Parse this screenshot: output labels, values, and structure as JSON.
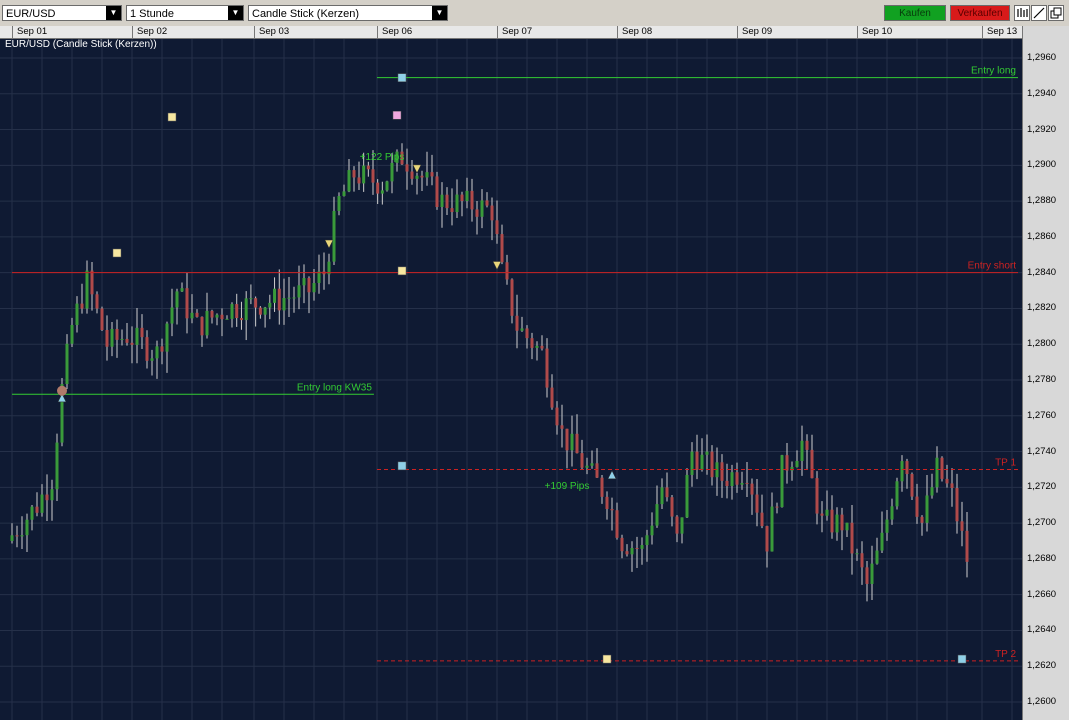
{
  "toolbar": {
    "instrument": "EUR/USD",
    "timeframe": "1 Stunde",
    "chart_type": "Candle Stick (Kerzen)",
    "buy_label": "Kaufen",
    "sell_label": "Verkaufen",
    "buy_color": "#11a121",
    "sell_color": "#d81a1a",
    "icons": [
      "chart-bars-icon",
      "draw-line-icon",
      "detach-window-icon"
    ]
  },
  "chart_title": "EUR/USD (Candle Stick (Kerzen))",
  "x_dates": [
    "Sep 01",
    "Sep 02",
    "Sep 03",
    "Sep 06",
    "Sep 07",
    "Sep 08",
    "Sep 09",
    "Sep 10",
    "Sep 13"
  ],
  "colors": {
    "background": "#0f1a33",
    "grid": "#253049",
    "bull_candle": "#3a9a3a",
    "bear_candle": "#b04a4a",
    "wick": "#cfcfcf",
    "entry_long_line": "#33cc33",
    "entry_short_line": "#cc2222",
    "tp_line": "#cc2222"
  },
  "chart_data": {
    "type": "candlestick",
    "title": "EUR/USD (Candle Stick (Kerzen))",
    "x_tick_labels": [
      "Sep 01",
      "Sep 02",
      "Sep 03",
      "Sep 06",
      "Sep 07",
      "Sep 08",
      "Sep 09",
      "Sep 10",
      "Sep 13"
    ],
    "y_tick_labels": [
      "1,2960",
      "1,2940",
      "1,2920",
      "1,2900",
      "1,2880",
      "1,2860",
      "1,2840",
      "1,2820",
      "1,2800",
      "1,2780",
      "1,2760",
      "1,2740",
      "1,2720",
      "1,2700",
      "1,2680",
      "1,2660",
      "1,2640",
      "1,2620",
      "1,2600"
    ],
    "ylim": [
      1.26,
      1.296
    ],
    "y_decimal_separator": ",",
    "grid": true,
    "path_points": [
      {
        "x": "Sep 01 00:00",
        "y": 1.269
      },
      {
        "x": "Sep 01 06:00",
        "y": 1.271
      },
      {
        "x": "Sep 01 09:00",
        "y": 1.2725
      },
      {
        "x": "Sep 01 11:00",
        "y": 1.2775
      },
      {
        "x": "Sep 01 13:00",
        "y": 1.281
      },
      {
        "x": "Sep 01 16:00",
        "y": 1.2835
      },
      {
        "x": "Sep 01 20:00",
        "y": 1.28
      },
      {
        "x": "Sep 02 00:00",
        "y": 1.2805
      },
      {
        "x": "Sep 02 06:00",
        "y": 1.2795
      },
      {
        "x": "Sep 02 10:00",
        "y": 1.283
      },
      {
        "x": "Sep 02 14:00",
        "y": 1.281
      },
      {
        "x": "Sep 02 20:00",
        "y": 1.282
      },
      {
        "x": "Sep 03 06:00",
        "y": 1.2825
      },
      {
        "x": "Sep 03 12:00",
        "y": 1.283
      },
      {
        "x": "Sep 03 15:00",
        "y": 1.284
      },
      {
        "x": "Sep 03 18:00",
        "y": 1.288
      },
      {
        "x": "Sep 03 21:00",
        "y": 1.2895
      },
      {
        "x": "Sep 06 02:00",
        "y": 1.289
      },
      {
        "x": "Sep 06 06:00",
        "y": 1.2905
      },
      {
        "x": "Sep 06 08:00",
        "y": 1.29
      },
      {
        "x": "Sep 06 14:00",
        "y": 1.288
      },
      {
        "x": "Sep 06 20:00",
        "y": 1.2878
      },
      {
        "x": "Sep 07 00:00",
        "y": 1.2875
      },
      {
        "x": "Sep 07 02:00",
        "y": 1.284
      },
      {
        "x": "Sep 07 05:00",
        "y": 1.281
      },
      {
        "x": "Sep 07 10:00",
        "y": 1.2795
      },
      {
        "x": "Sep 07 14:00",
        "y": 1.275
      },
      {
        "x": "Sep 07 19:00",
        "y": 1.273
      },
      {
        "x": "Sep 07 23:00",
        "y": 1.2715
      },
      {
        "x": "Sep 08 02:00",
        "y": 1.269
      },
      {
        "x": "Sep 08 06:00",
        "y": 1.2685
      },
      {
        "x": "Sep 08 10:00",
        "y": 1.272
      },
      {
        "x": "Sep 08 13:00",
        "y": 1.269
      },
      {
        "x": "Sep 08 16:00",
        "y": 1.274
      },
      {
        "x": "Sep 08 22:00",
        "y": 1.2725
      },
      {
        "x": "Sep 09 03:00",
        "y": 1.273
      },
      {
        "x": "Sep 09 07:00",
        "y": 1.269
      },
      {
        "x": "Sep 09 10:00",
        "y": 1.273
      },
      {
        "x": "Sep 09 14:00",
        "y": 1.2745
      },
      {
        "x": "Sep 09 18:00",
        "y": 1.27
      },
      {
        "x": "Sep 09 22:00",
        "y": 1.27
      },
      {
        "x": "Sep 10 03:00",
        "y": 1.2665
      },
      {
        "x": "Sep 10 06:00",
        "y": 1.269
      },
      {
        "x": "Sep 10 10:00",
        "y": 1.274
      },
      {
        "x": "Sep 10 14:00",
        "y": 1.27
      },
      {
        "x": "Sep 10 17:00",
        "y": 1.273
      },
      {
        "x": "Sep 10 20:00",
        "y": 1.2715
      },
      {
        "x": "Sep 10 23:00",
        "y": 1.268
      }
    ],
    "h_lines": [
      {
        "label": "Entry long",
        "price": 1.2949,
        "from": "Sep 06 00:00",
        "color": "#33cc33",
        "style": "solid"
      },
      {
        "label": "Entry short",
        "price": 1.284,
        "from": "Sep 01 00:00",
        "color": "#cc2222",
        "style": "solid"
      },
      {
        "label": "Entry long KW35",
        "price": 1.2772,
        "from": "Sep 01 00:00",
        "to": "Sep 03 23:59",
        "color": "#33cc33",
        "style": "solid"
      },
      {
        "label": "TP 1",
        "price": 1.273,
        "from": "Sep 06 00:00",
        "color": "#cc2222",
        "style": "dashed"
      },
      {
        "label": "TP 2",
        "price": 1.2623,
        "from": "Sep 06 00:00",
        "color": "#cc2222",
        "style": "dashed"
      }
    ],
    "annotations": [
      {
        "text": "+122 Pips",
        "x": "Sep 06 01:00",
        "price": 1.2903,
        "color": "#33cc33"
      },
      {
        "text": "+109 Pips",
        "x": "Sep 07 14:00",
        "price": 1.2719,
        "color": "#33cc33"
      }
    ],
    "arrows": [
      {
        "direction": "down",
        "x": "Sep 03 15:00",
        "price": 1.2856,
        "color": "#e8d67a"
      },
      {
        "direction": "down",
        "x": "Sep 06 08:00",
        "price": 1.2898,
        "color": "#e8d67a"
      },
      {
        "direction": "down",
        "x": "Sep 07 00:00",
        "price": 1.2844,
        "color": "#e8d67a"
      },
      {
        "direction": "up",
        "x": "Sep 01 10:00",
        "price": 1.277,
        "color": "#8fd0e8"
      },
      {
        "direction": "up",
        "x": "Sep 07 23:00",
        "price": 1.2727,
        "color": "#8fd0e8"
      }
    ],
    "markers": [
      {
        "shape": "square",
        "x": "Sep 02 08:00",
        "price": 1.2927,
        "color": "#f7e7a0"
      },
      {
        "shape": "square",
        "x": "Sep 01 21:00",
        "price": 1.2851,
        "color": "#f7e7a0"
      },
      {
        "shape": "square",
        "x": "Sep 06 05:00",
        "price": 1.2949,
        "color": "#8fd0e8"
      },
      {
        "shape": "square",
        "x": "Sep 06 04:00",
        "price": 1.2928,
        "color": "#f0a8e0"
      },
      {
        "shape": "square",
        "x": "Sep 06 05:00",
        "price": 1.2841,
        "color": "#f7e7a0"
      },
      {
        "shape": "square",
        "x": "Sep 06 05:00",
        "price": 1.2732,
        "color": "#8fd0e8"
      },
      {
        "shape": "square",
        "x": "Sep 07 22:00",
        "price": 1.2624,
        "color": "#f7e7a0"
      },
      {
        "shape": "square",
        "x": "Sep 10 21:00",
        "price": 1.2624,
        "color": "#8fd0e8"
      },
      {
        "shape": "circle",
        "x": "Sep 01 10:00",
        "price": 1.2774,
        "color": "#b07a6a"
      }
    ]
  }
}
